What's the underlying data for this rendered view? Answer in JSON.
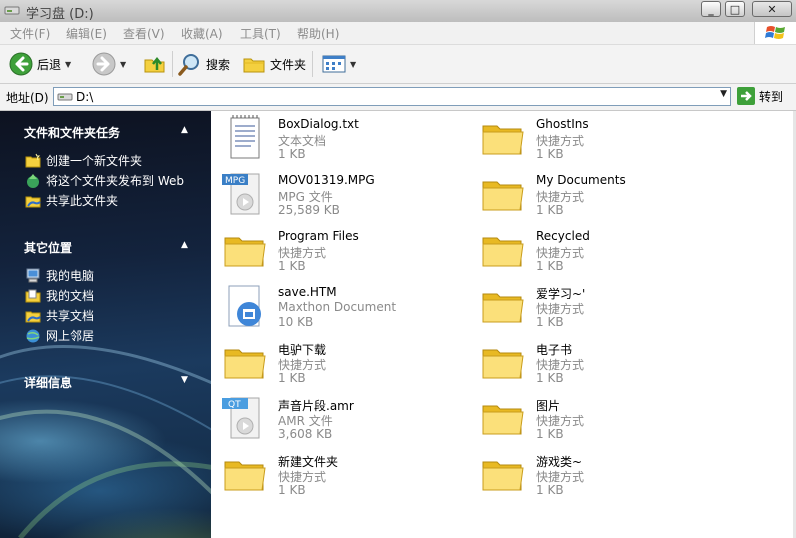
{
  "window": {
    "title": "学习盘 (D:)"
  },
  "menu": {
    "items": [
      "文件(F)",
      "编辑(E)",
      "查看(V)",
      "收藏(A)",
      "工具(T)",
      "帮助(H)"
    ]
  },
  "toolbar": {
    "back_label": "后退",
    "search_label": "搜索",
    "folders_label": "文件夹"
  },
  "address": {
    "label": "地址(D)",
    "value": "D:\\",
    "go_label": "转到"
  },
  "left_pane": {
    "tasks": {
      "title": "文件和文件夹任务",
      "items": [
        {
          "label": "创建一个新文件夹",
          "icon": "new-folder-icon"
        },
        {
          "label": "将这个文件夹发布到 Web",
          "icon": "publish-web-icon"
        },
        {
          "label": "共享此文件夹",
          "icon": "share-folder-icon"
        }
      ]
    },
    "places": {
      "title": "其它位置",
      "items": [
        {
          "label": "我的电脑",
          "icon": "my-computer-icon"
        },
        {
          "label": "我的文档",
          "icon": "my-documents-icon"
        },
        {
          "label": "共享文档",
          "icon": "shared-documents-icon"
        },
        {
          "label": "网上邻居",
          "icon": "network-places-icon"
        }
      ]
    },
    "details": {
      "title": "详细信息"
    }
  },
  "files": [
    {
      "name": "BoxDialog.txt",
      "type": "文本文档",
      "size": "1 KB",
      "icon": "text-file-icon"
    },
    {
      "name": "GhostIns",
      "type": "快捷方式",
      "size": "1 KB",
      "icon": "folder-icon"
    },
    {
      "name": "MOV01319.MPG",
      "type": "MPG 文件",
      "size": "25,589 KB",
      "icon": "mpg-file-icon"
    },
    {
      "name": "My Documents",
      "type": "快捷方式",
      "size": "1 KB",
      "icon": "folder-icon"
    },
    {
      "name": "Program Files",
      "type": "快捷方式",
      "size": "1 KB",
      "icon": "folder-icon"
    },
    {
      "name": "Recycled",
      "type": "快捷方式",
      "size": "1 KB",
      "icon": "folder-icon"
    },
    {
      "name": "save.HTM",
      "type": "Maxthon Document",
      "size": "10 KB",
      "icon": "html-file-icon"
    },
    {
      "name": "爱学习~'",
      "type": "快捷方式",
      "size": "1 KB",
      "icon": "folder-icon"
    },
    {
      "name": "电驴下载",
      "type": "快捷方式",
      "size": "1 KB",
      "icon": "folder-icon"
    },
    {
      "name": "电子书",
      "type": "快捷方式",
      "size": "1 KB",
      "icon": "folder-icon"
    },
    {
      "name": "声音片段.amr",
      "type": "AMR 文件",
      "size": "3,608 KB",
      "icon": "amr-file-icon"
    },
    {
      "name": "图片",
      "type": "快捷方式",
      "size": "1 KB",
      "icon": "folder-icon"
    },
    {
      "name": "新建文件夹",
      "type": "快捷方式",
      "size": "1 KB",
      "icon": "folder-icon"
    },
    {
      "name": "游戏类~",
      "type": "快捷方式",
      "size": "1 KB",
      "icon": "folder-icon"
    }
  ]
}
